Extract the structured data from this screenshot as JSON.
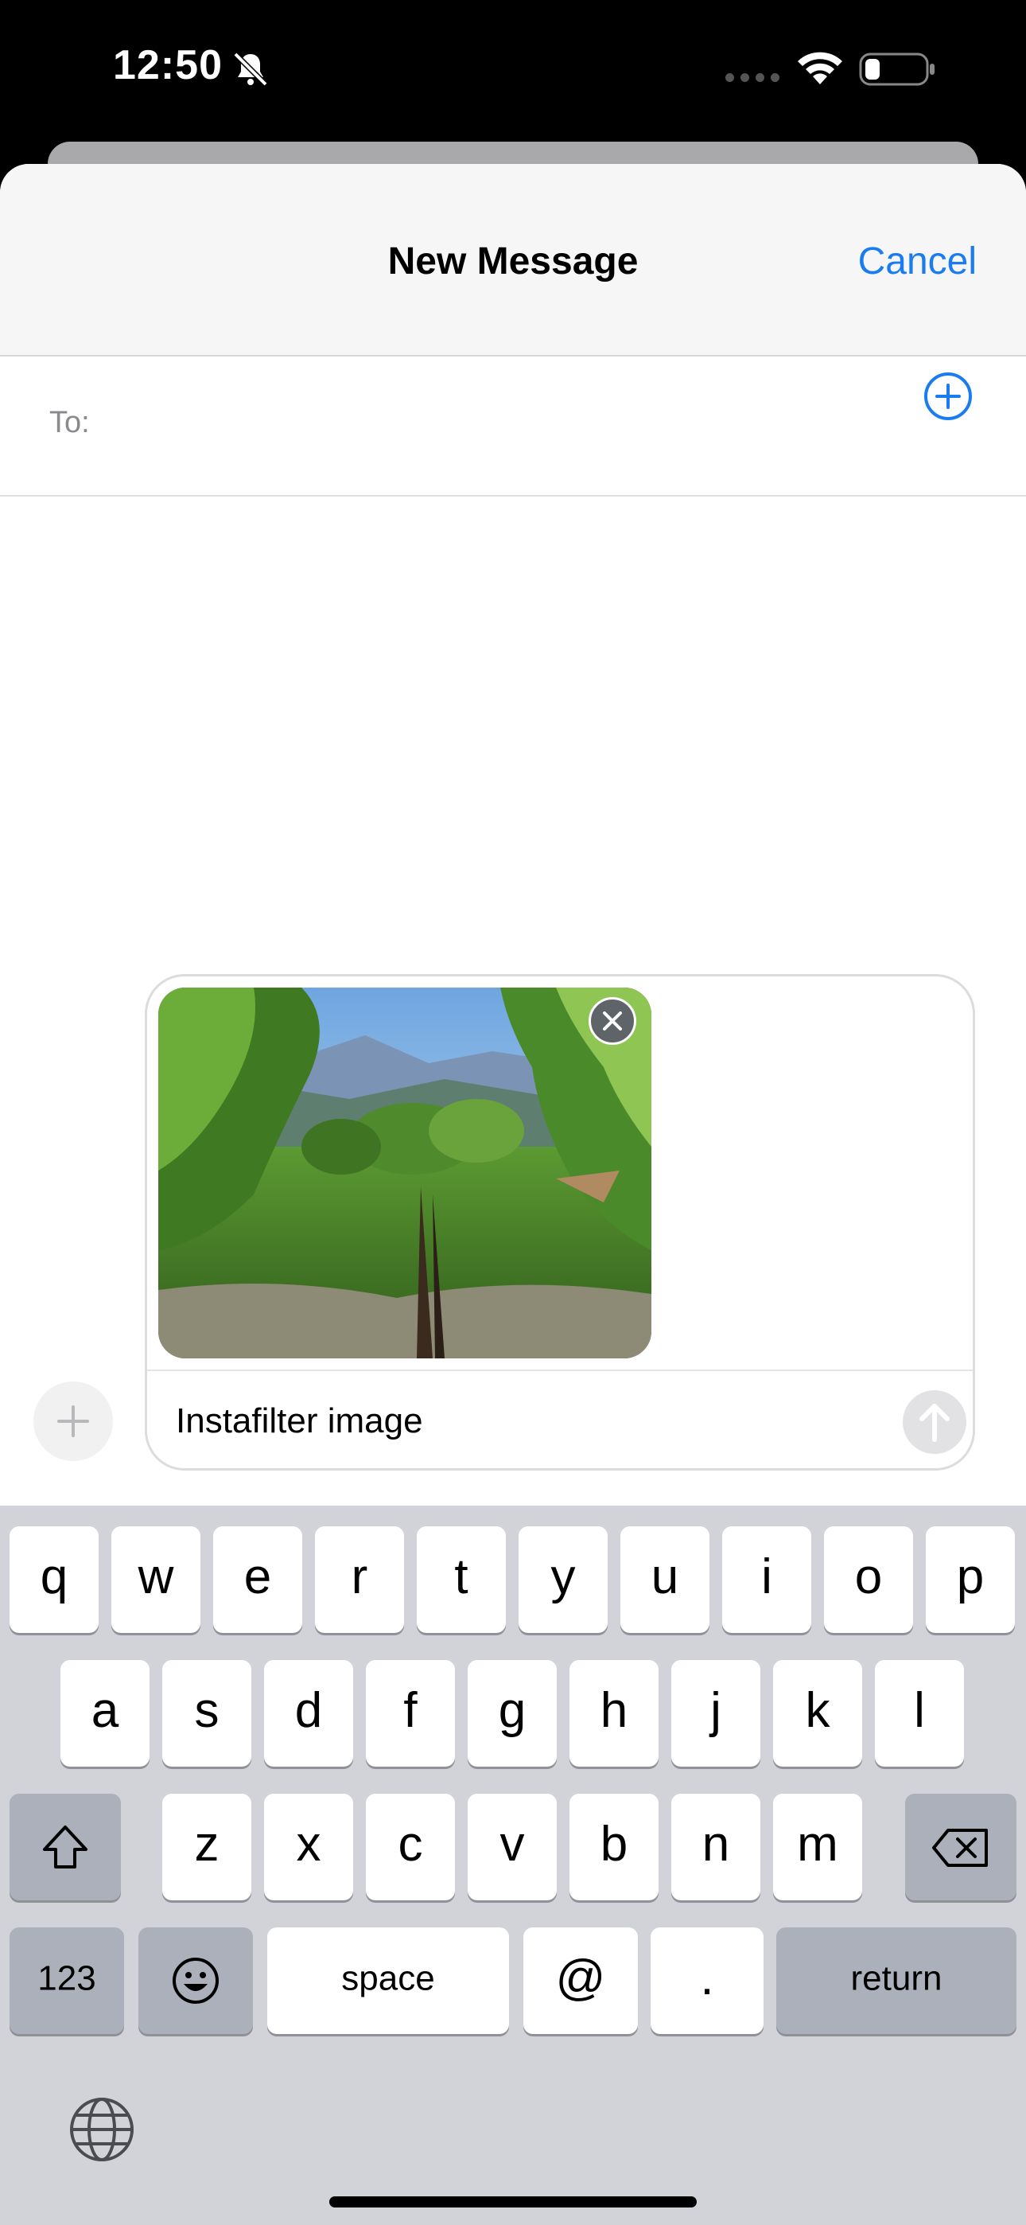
{
  "status": {
    "time": "12:50"
  },
  "header": {
    "title": "New Message",
    "cancel_label": "Cancel"
  },
  "to": {
    "label": "To:"
  },
  "compose": {
    "message_text": "Instafilter image"
  },
  "keyboard": {
    "row1": [
      "q",
      "w",
      "e",
      "r",
      "t",
      "y",
      "u",
      "i",
      "o",
      "p"
    ],
    "row2": [
      "a",
      "s",
      "d",
      "f",
      "g",
      "h",
      "j",
      "k",
      "l"
    ],
    "row3": [
      "z",
      "x",
      "c",
      "v",
      "b",
      "n",
      "m"
    ],
    "numbers_label": "123",
    "space_label": "space",
    "at_label": "@",
    "period_label": ".",
    "return_label": "return"
  },
  "colors": {
    "accent": "#1a7cf0",
    "keyboard_bg": "#d1d3d9"
  }
}
